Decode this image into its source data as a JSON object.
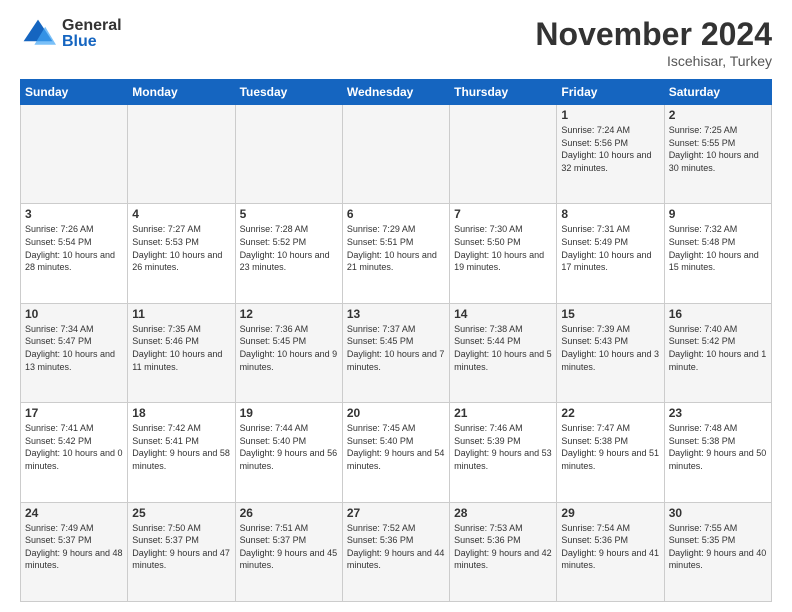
{
  "header": {
    "logo_general": "General",
    "logo_blue": "Blue",
    "month_title": "November 2024",
    "location": "Iscehisar, Turkey"
  },
  "days_of_week": [
    "Sunday",
    "Monday",
    "Tuesday",
    "Wednesday",
    "Thursday",
    "Friday",
    "Saturday"
  ],
  "weeks": [
    {
      "days": [
        {
          "num": "",
          "info": ""
        },
        {
          "num": "",
          "info": ""
        },
        {
          "num": "",
          "info": ""
        },
        {
          "num": "",
          "info": ""
        },
        {
          "num": "",
          "info": ""
        },
        {
          "num": "1",
          "info": "Sunrise: 7:24 AM\nSunset: 5:56 PM\nDaylight: 10 hours and 32 minutes."
        },
        {
          "num": "2",
          "info": "Sunrise: 7:25 AM\nSunset: 5:55 PM\nDaylight: 10 hours and 30 minutes."
        }
      ]
    },
    {
      "days": [
        {
          "num": "3",
          "info": "Sunrise: 7:26 AM\nSunset: 5:54 PM\nDaylight: 10 hours and 28 minutes."
        },
        {
          "num": "4",
          "info": "Sunrise: 7:27 AM\nSunset: 5:53 PM\nDaylight: 10 hours and 26 minutes."
        },
        {
          "num": "5",
          "info": "Sunrise: 7:28 AM\nSunset: 5:52 PM\nDaylight: 10 hours and 23 minutes."
        },
        {
          "num": "6",
          "info": "Sunrise: 7:29 AM\nSunset: 5:51 PM\nDaylight: 10 hours and 21 minutes."
        },
        {
          "num": "7",
          "info": "Sunrise: 7:30 AM\nSunset: 5:50 PM\nDaylight: 10 hours and 19 minutes."
        },
        {
          "num": "8",
          "info": "Sunrise: 7:31 AM\nSunset: 5:49 PM\nDaylight: 10 hours and 17 minutes."
        },
        {
          "num": "9",
          "info": "Sunrise: 7:32 AM\nSunset: 5:48 PM\nDaylight: 10 hours and 15 minutes."
        }
      ]
    },
    {
      "days": [
        {
          "num": "10",
          "info": "Sunrise: 7:34 AM\nSunset: 5:47 PM\nDaylight: 10 hours and 13 minutes."
        },
        {
          "num": "11",
          "info": "Sunrise: 7:35 AM\nSunset: 5:46 PM\nDaylight: 10 hours and 11 minutes."
        },
        {
          "num": "12",
          "info": "Sunrise: 7:36 AM\nSunset: 5:45 PM\nDaylight: 10 hours and 9 minutes."
        },
        {
          "num": "13",
          "info": "Sunrise: 7:37 AM\nSunset: 5:45 PM\nDaylight: 10 hours and 7 minutes."
        },
        {
          "num": "14",
          "info": "Sunrise: 7:38 AM\nSunset: 5:44 PM\nDaylight: 10 hours and 5 minutes."
        },
        {
          "num": "15",
          "info": "Sunrise: 7:39 AM\nSunset: 5:43 PM\nDaylight: 10 hours and 3 minutes."
        },
        {
          "num": "16",
          "info": "Sunrise: 7:40 AM\nSunset: 5:42 PM\nDaylight: 10 hours and 1 minute."
        }
      ]
    },
    {
      "days": [
        {
          "num": "17",
          "info": "Sunrise: 7:41 AM\nSunset: 5:42 PM\nDaylight: 10 hours and 0 minutes."
        },
        {
          "num": "18",
          "info": "Sunrise: 7:42 AM\nSunset: 5:41 PM\nDaylight: 9 hours and 58 minutes."
        },
        {
          "num": "19",
          "info": "Sunrise: 7:44 AM\nSunset: 5:40 PM\nDaylight: 9 hours and 56 minutes."
        },
        {
          "num": "20",
          "info": "Sunrise: 7:45 AM\nSunset: 5:40 PM\nDaylight: 9 hours and 54 minutes."
        },
        {
          "num": "21",
          "info": "Sunrise: 7:46 AM\nSunset: 5:39 PM\nDaylight: 9 hours and 53 minutes."
        },
        {
          "num": "22",
          "info": "Sunrise: 7:47 AM\nSunset: 5:38 PM\nDaylight: 9 hours and 51 minutes."
        },
        {
          "num": "23",
          "info": "Sunrise: 7:48 AM\nSunset: 5:38 PM\nDaylight: 9 hours and 50 minutes."
        }
      ]
    },
    {
      "days": [
        {
          "num": "24",
          "info": "Sunrise: 7:49 AM\nSunset: 5:37 PM\nDaylight: 9 hours and 48 minutes."
        },
        {
          "num": "25",
          "info": "Sunrise: 7:50 AM\nSunset: 5:37 PM\nDaylight: 9 hours and 47 minutes."
        },
        {
          "num": "26",
          "info": "Sunrise: 7:51 AM\nSunset: 5:37 PM\nDaylight: 9 hours and 45 minutes."
        },
        {
          "num": "27",
          "info": "Sunrise: 7:52 AM\nSunset: 5:36 PM\nDaylight: 9 hours and 44 minutes."
        },
        {
          "num": "28",
          "info": "Sunrise: 7:53 AM\nSunset: 5:36 PM\nDaylight: 9 hours and 42 minutes."
        },
        {
          "num": "29",
          "info": "Sunrise: 7:54 AM\nSunset: 5:36 PM\nDaylight: 9 hours and 41 minutes."
        },
        {
          "num": "30",
          "info": "Sunrise: 7:55 AM\nSunset: 5:35 PM\nDaylight: 9 hours and 40 minutes."
        }
      ]
    }
  ]
}
